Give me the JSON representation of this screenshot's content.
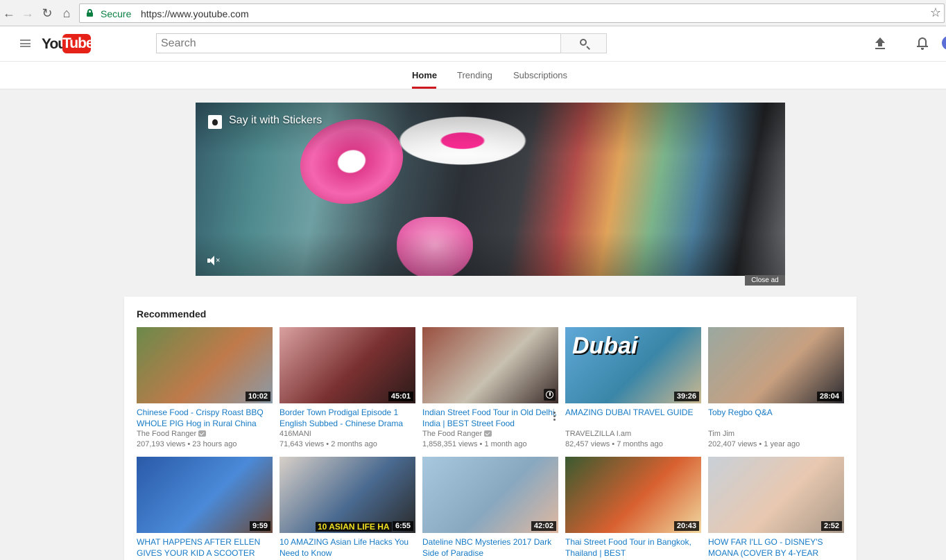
{
  "browser": {
    "secure_label": "Secure",
    "url": "https://www.youtube.com"
  },
  "header": {
    "logo_you": "You",
    "logo_tube": "Tube",
    "search_placeholder": "Search"
  },
  "tabs": [
    {
      "label": "Home",
      "active": true
    },
    {
      "label": "Trending",
      "active": false
    },
    {
      "label": "Subscriptions",
      "active": false
    }
  ],
  "ad": {
    "title": "Say it with Stickers",
    "close_label": "Close ad"
  },
  "shelf": {
    "title": "Recommended",
    "videos": [
      {
        "title": "Chinese Food - Crispy Roast BBQ WHOLE PIG Hog in Rural China",
        "channel": "The Food Ranger",
        "verified": true,
        "views": "207,193 views",
        "age": "23 hours ago",
        "duration": "10:02",
        "thumb_colors": [
          "#6b8a4b",
          "#c07a4a",
          "#8a9aa8"
        ]
      },
      {
        "title": "Border Town Prodigal Episode 1 English Subbed - Chinese Drama",
        "channel": "416MANI",
        "verified": false,
        "views": "71,643 views",
        "age": "2 months ago",
        "duration": "45:01",
        "thumb_colors": [
          "#d9a0a0",
          "#7a3030",
          "#2a1a1a"
        ]
      },
      {
        "title": "Indian Street Food Tour in Old Delhi, India | BEST Street Food",
        "channel": "The Food Ranger",
        "verified": true,
        "views": "1,858,351 views",
        "age": "1 month ago",
        "duration": "",
        "thumb_colors": [
          "#9a5040",
          "#c8c0b0",
          "#3a2a28"
        ]
      },
      {
        "title": "AMAZING DUBAI TRAVEL GUIDE",
        "channel": "TRAVELZILLA I.am",
        "verified": false,
        "views": "82,457 views",
        "age": "7 months ago",
        "duration": "39:26",
        "thumb_colors": [
          "#5fa8d8",
          "#3a86a8",
          "#cbb890"
        ],
        "thumb_label": "Dubai"
      },
      {
        "title": "Toby Regbo Q&A",
        "channel": "Tim Jim",
        "verified": false,
        "views": "202,407 views",
        "age": "1 year ago",
        "duration": "28:04",
        "thumb_colors": [
          "#9aa8a0",
          "#c8a080",
          "#2a2a30"
        ]
      },
      {
        "title": "WHAT HAPPENS AFTER ELLEN GIVES YOUR KID A SCOOTER",
        "channel": "",
        "verified": false,
        "views": "",
        "age": "",
        "duration": "9:59",
        "thumb_colors": [
          "#2a5aa8",
          "#4a8ad8",
          "#6a4a3a"
        ]
      },
      {
        "title": "10 AMAZING Asian Life Hacks You Need to Know",
        "channel": "",
        "verified": false,
        "views": "",
        "age": "",
        "duration": "6:55",
        "thumb_colors": [
          "#d8d0c8",
          "#4a6a90",
          "#2a2a2a"
        ],
        "thumb_banner": "10 ASIAN LIFE HA"
      },
      {
        "title": "Dateline NBC Mysteries 2017 Dark Side of Paradise",
        "channel": "",
        "verified": false,
        "views": "",
        "age": "",
        "duration": "42:02",
        "thumb_colors": [
          "#a8c8e0",
          "#88a8c0",
          "#e0b8a0"
        ]
      },
      {
        "title": "Thai Street Food Tour in Bangkok, Thailand | BEST",
        "channel": "",
        "verified": false,
        "views": "",
        "age": "",
        "duration": "20:43",
        "thumb_colors": [
          "#3a5a30",
          "#d86030",
          "#f0d8a0"
        ]
      },
      {
        "title": "HOW FAR I'LL GO - DISNEY'S MOANA (COVER BY 4-YEAR",
        "channel": "",
        "verified": false,
        "views": "",
        "age": "",
        "duration": "2:52",
        "thumb_colors": [
          "#c8d0d8",
          "#e8c8b0",
          "#a89888"
        ]
      }
    ]
  }
}
